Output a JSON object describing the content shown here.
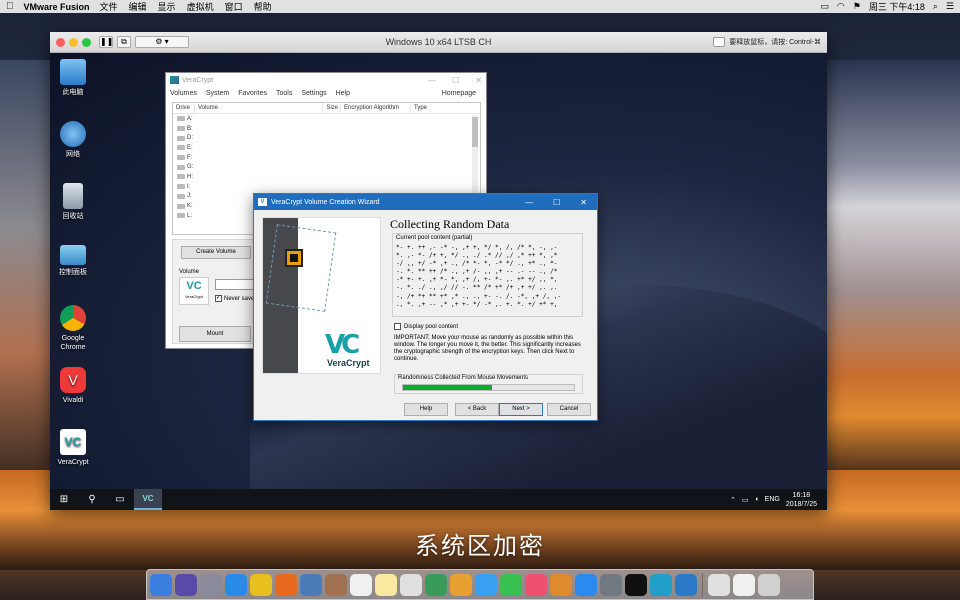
{
  "mac_menubar": {
    "app_name": "VMware Fusion",
    "items": [
      "文件",
      "编辑",
      "显示",
      "虚拟机",
      "窗口",
      "帮助"
    ],
    "clock": "周三 下午4:18"
  },
  "caption": "系统区加密",
  "vm": {
    "title": "Windows 10 x64 LTSB CH",
    "hint": "要释放鼠标，请按: Control-⌘"
  },
  "desktop_icons": [
    {
      "label": "此电脑",
      "color": "#4aa0e0"
    },
    {
      "label": "网络",
      "color": "#3a8ad0"
    },
    {
      "label": "回收站",
      "color": "#a8b8c8"
    },
    {
      "label": "控制面板",
      "color": "#58a8e0"
    },
    {
      "label": "Google Chrome",
      "color": "#e8c020"
    },
    {
      "label": "Vivaldi",
      "color": "#e03030"
    },
    {
      "label": "VeraCrypt",
      "color": "#1aa0a6"
    }
  ],
  "veracrypt_main": {
    "title": "VeraCrypt",
    "menu": [
      "Volumes",
      "System",
      "Favorites",
      "Tools",
      "Settings",
      "Help"
    ],
    "homepage": "Homepage",
    "columns": [
      "Drive",
      "Volume",
      "Size",
      "Encryption Algorithm",
      "Type"
    ],
    "drives": [
      "A:",
      "B:",
      "D:",
      "E:",
      "F:",
      "G:",
      "H:",
      "I:",
      "J:",
      "K:",
      "L:"
    ],
    "create_volume": "Create Volume",
    "volume_label": "Volume",
    "never_save": "Never save",
    "mount": "Mount",
    "logo_text": "VeraCrypt"
  },
  "wizard": {
    "title": "VeraCrypt Volume Creation Wizard",
    "heading": "Collecting Random Data",
    "pool_label": "Current pool content (partial)",
    "pool_content": "*- +. ++ ,- -* -, ,+ +, */ *, /, /* *, -, ,-\n*. ,- *- /+ +, */ ., ./ .* // ,/ ,* ++ *, ,*\n-/ ,, +/ -* ,+ ., /* *- *, -* */ ., +* ., *-\n-. *. ** ++ /* ., ,+ /- ,, ,+ -- .- -- ., /*\n-* +- +. ,+ *- *, ,+ /, +- *- ,. +* +/ ,, *,\n-. *. ./ ., ,/ // -. ** /* +* /+ ,+ +/ ,. ,.\n-, /+ *+ ** +* ,* ., ., +- -. /. -*, ,+ /, ,-\n., *. ,+ -- ,* ,+ +- */ -* ,. +. *. +/ +* +,",
    "display_pool": "Display pool content",
    "important": "IMPORTANT: Move your mouse as randomly as possible within this window. The longer you move it, the better. This significantly increases the cryptographic strength of the encryption keys. Then click Next to continue.",
    "randomness_label": "Randomness Collected From Mouse Movements",
    "randomness_fraction": 0.52,
    "buttons": {
      "help": "Help",
      "back": "< Back",
      "next": "Next >",
      "cancel": "Cancel"
    },
    "logo_name": "VeraCrypt",
    "logo_mark": "VC"
  },
  "taskbar": {
    "ime": "ENG",
    "time": "16:18",
    "date": "2018/7/25"
  },
  "dock_colors": [
    "#3a7ee0",
    "#5a4aa8",
    "#8a8a9a",
    "#2a8ae8",
    "#e8c020",
    "#e86a20",
    "#4a7ab8",
    "#a07050",
    "#f0f0f0",
    "#f8e8a0",
    "#e0e0e0",
    "#3a9a5a",
    "#e8a030",
    "#38a0f0",
    "#38c050",
    "#f05070",
    "#e08a30",
    "#2a8af0",
    "#707880",
    "#101010",
    "#20a0c8",
    "#2a7ac8",
    "#e0e0e0",
    "#f0f0f0",
    "#d0d0d0"
  ]
}
